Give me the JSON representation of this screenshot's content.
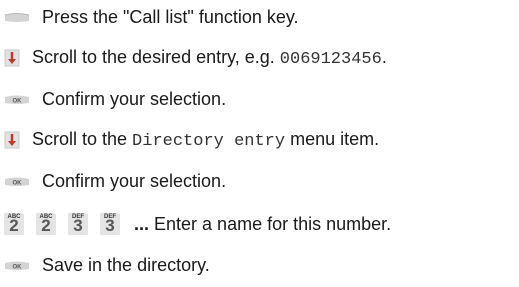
{
  "steps": [
    {
      "icon": "function-key-icon",
      "text": "Press the \"Call list\" function key."
    },
    {
      "icon": "scroll-arrow-icon",
      "text_before": "Scroll to the desired entry, e.g. ",
      "mono": "0069123456",
      "text_after": "."
    },
    {
      "icon": "ok-key-icon",
      "text": "Confirm your selection."
    },
    {
      "icon": "scroll-arrow-icon",
      "text_before": "Scroll to the ",
      "mono": "Directory entry",
      "text_after": " menu item."
    },
    {
      "icon": "ok-key-icon",
      "text": "Confirm your selection."
    },
    {
      "icon": "keypad-keys-icon",
      "keys": [
        {
          "letters": "ABC",
          "digit": "2"
        },
        {
          "letters": "ABC",
          "digit": "2"
        },
        {
          "letters": "DEF",
          "digit": "3"
        },
        {
          "letters": "DEF",
          "digit": "3"
        }
      ],
      "ellipsis": "...",
      "text": " Enter a name for this number."
    },
    {
      "icon": "ok-key-icon",
      "text": "Save in the directory."
    }
  ],
  "ok_key_label": "OK",
  "colors": {
    "key_gray": "#d8d8d8",
    "arrow_red": "#c0392b",
    "text": "#1a1a1a"
  }
}
